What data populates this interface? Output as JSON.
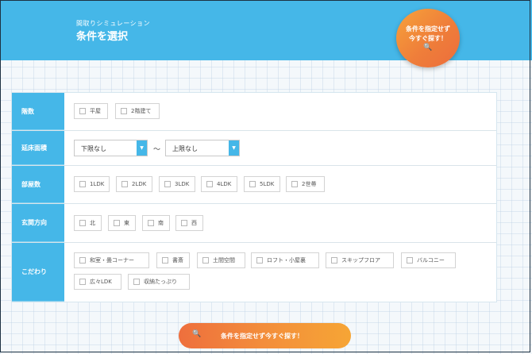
{
  "header": {
    "subtitle": "間取りシミュレーション",
    "title": "条件を選択"
  },
  "circle_button": {
    "line1": "条件を指定せず",
    "line2": "今すぐ探す！",
    "icon": "search-icon",
    "glyph": "🔍"
  },
  "rows": {
    "floors": {
      "label": "階数",
      "options": [
        "平屋",
        "2階建て"
      ]
    },
    "area": {
      "label": "延床面積",
      "min_value": "下限なし",
      "separator": "〜",
      "max_value": "上限なし",
      "arrow": "▼"
    },
    "rooms": {
      "label": "部屋数",
      "options": [
        "1LDK",
        "2LDK",
        "3LDK",
        "4LDK",
        "5LDK",
        "2世帯"
      ]
    },
    "entrance": {
      "label": "玄関方向",
      "options": [
        "北",
        "東",
        "南",
        "西"
      ]
    },
    "features": {
      "label": "こだわり",
      "options": [
        "和室・畳コーナー",
        "書斎",
        "土間空間",
        "ロフト・小屋裏",
        "スキップフロア",
        "バルコニー",
        "広々LDK",
        "収納たっぷり"
      ]
    }
  },
  "bottom_button": {
    "label": "条件を指定せず今すぐ探す！",
    "icon": "search-icon",
    "glyph": "🔍"
  },
  "colors": {
    "header": "#45b7e8",
    "label_cell": "#45b7e8",
    "accent_orange": "#f08a3a"
  }
}
